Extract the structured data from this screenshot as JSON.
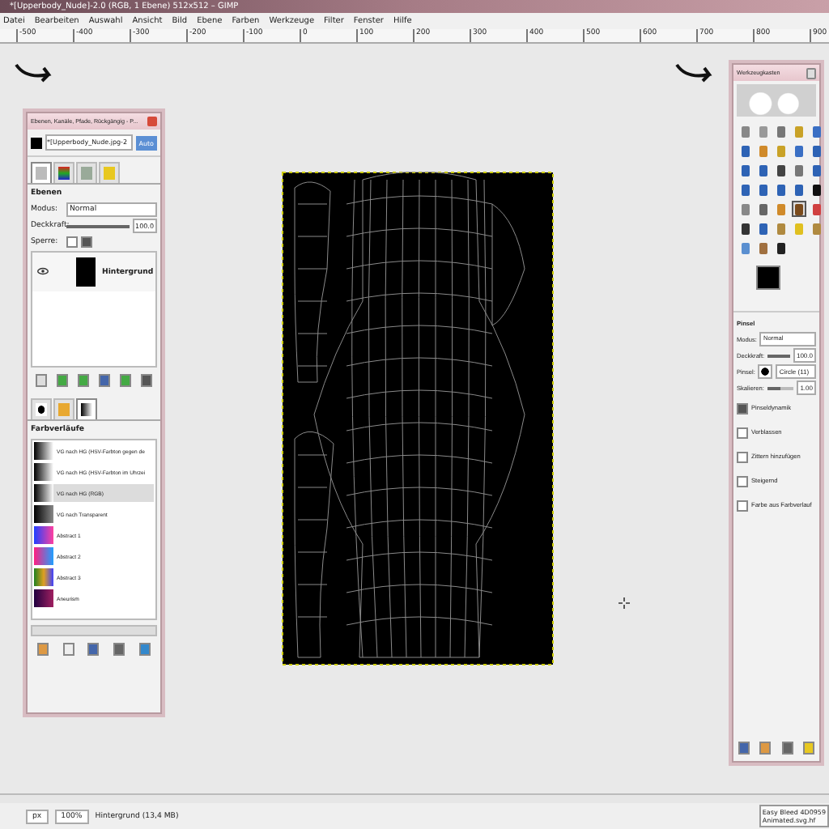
{
  "window": {
    "title": "*[Upperbody_Nude]-2.0 (RGB, 1 Ebene) 512x512 – GIMP"
  },
  "menu": [
    "Datei",
    "Bearbeiten",
    "Auswahl",
    "Ansicht",
    "Bild",
    "Ebene",
    "Farben",
    "Werkzeuge",
    "Filter",
    "Fenster",
    "Hilfe"
  ],
  "ruler": [
    "-500",
    "-400",
    "-300",
    "-200",
    "-100",
    "0",
    "100",
    "200",
    "300",
    "400",
    "500",
    "600",
    "700",
    "800",
    "900"
  ],
  "layers_dock": {
    "title": "Ebenen, Kanäle, Pfade, Rückgängig - P...",
    "image": "*[Upperbody_Nude.jpg-2",
    "auto": "Auto",
    "tabs": [
      {
        "selected": true
      },
      {
        "selected": false
      },
      {
        "selected": false
      },
      {
        "selected": false
      }
    ],
    "heading": "Ebenen",
    "mode_label": "Modus:",
    "mode": "Normal",
    "opacity_label": "Deckkraft:",
    "opacity": {
      "level": 1.0
    },
    "opacity_value": "100.0",
    "lock_label": "Sperre:",
    "locks": [
      {
        "checked": false
      },
      {
        "checked": true
      }
    ],
    "layers": [
      {
        "name": "Hintergrund",
        "visible": true,
        "selected": false
      }
    ],
    "bottom_tabs": [
      {
        "selected": false
      },
      {
        "selected": false
      },
      {
        "selected": true
      }
    ],
    "gradients_heading": "Farbverläufe",
    "gradients": [
      {
        "name": "VG nach HG (HSV-Farbton gegen de",
        "selected": false
      },
      {
        "name": "VG nach HG (HSV-Farbton im Uhrzei",
        "selected": false
      },
      {
        "name": "VG nach HG (RGB)",
        "selected": true
      },
      {
        "name": "VG nach Transparent",
        "selected": false
      },
      {
        "name": "Abstract 1",
        "selected": false
      },
      {
        "name": "Abstract 2",
        "selected": false
      },
      {
        "name": "Abstract 3",
        "selected": false
      },
      {
        "name": "Aneurism",
        "selected": false
      }
    ]
  },
  "toolbox": {
    "title": "Werkzeugkasten",
    "tools": [
      {
        "selected": false
      },
      {
        "selected": false
      },
      {
        "selected": false
      },
      {
        "selected": false
      },
      {
        "selected": false
      },
      {
        "selected": false
      },
      {
        "selected": false
      },
      {
        "selected": false
      },
      {
        "selected": false
      },
      {
        "selected": false
      },
      {
        "selected": false
      },
      {
        "selected": false
      },
      {
        "selected": false
      },
      {
        "selected": false
      },
      {
        "selected": false
      },
      {
        "selected": false
      },
      {
        "selected": false
      },
      {
        "selected": false
      },
      {
        "selected": false
      },
      {
        "selected": false
      },
      {
        "selected": false
      },
      {
        "selected": false
      },
      {
        "selected": false
      },
      {
        "selected": true
      },
      {
        "selected": false
      },
      {
        "selected": false
      },
      {
        "selected": false
      },
      {
        "selected": false
      },
      {
        "selected": false
      },
      {
        "selected": false
      },
      {
        "selected": false
      },
      {
        "selected": false
      },
      {
        "selected": false
      }
    ],
    "options_title": "Pinsel",
    "mode_label": "Modus:",
    "mode": "Normal",
    "opacity_label": "Deckkraft:",
    "opacity": {
      "level": 1.0
    },
    "opacity_value": "100.0",
    "brush_label": "Pinsel:",
    "brush": "Circle (11)",
    "scale_label": "Skalieren:",
    "scale": {
      "level": 0.5
    },
    "scale_value": "1.00",
    "options": [
      {
        "label": "Pinseldynamik",
        "checked": true
      },
      {
        "label": "Verblassen",
        "checked": false
      },
      {
        "label": "Zittern hinzufügen",
        "checked": false
      },
      {
        "label": "Steigernd",
        "checked": false
      },
      {
        "label": "Farbe aus Farbverlauf",
        "checked": false
      }
    ]
  },
  "status_bar": {
    "unit": "px",
    "zoom": "100%",
    "info": "Hintergrund (13,4 MB)",
    "note_lines": [
      "Easy Bleed 4D0959",
      "Animated.svg.hf"
    ]
  }
}
